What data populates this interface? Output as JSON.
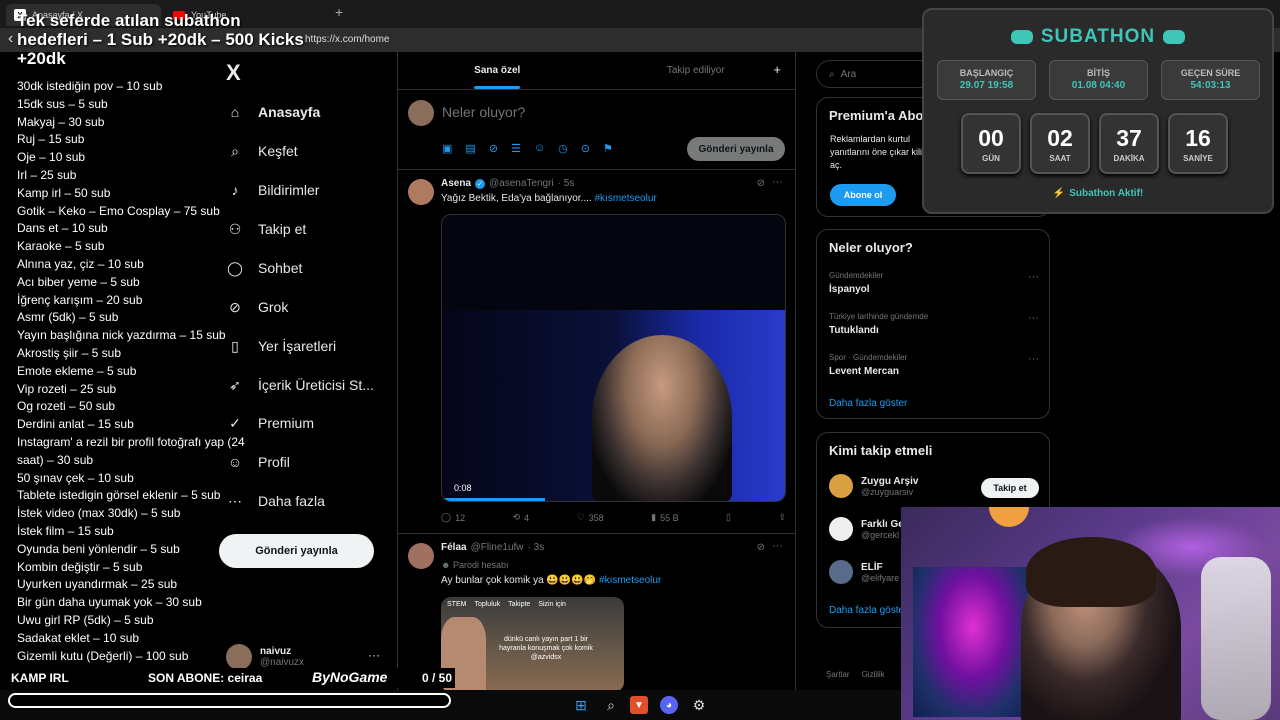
{
  "browser": {
    "tabs": [
      {
        "label": "Anasayfa / X"
      },
      {
        "label": "YouTube"
      }
    ],
    "new_tab": "+",
    "url": "https://x.com/home"
  },
  "left_nav": {
    "logo": "X",
    "items": [
      {
        "label": "Anasayfa",
        "icon": "home-icon",
        "active": true
      },
      {
        "label": "Keşfet",
        "icon": "search-icon"
      },
      {
        "label": "Bildirimler",
        "icon": "bell-icon"
      },
      {
        "label": "Takip et",
        "icon": "add-user-icon"
      },
      {
        "label": "Sohbet",
        "icon": "chat-icon"
      },
      {
        "label": "Grok",
        "icon": "grok-icon"
      },
      {
        "label": "Yer İşaretleri",
        "icon": "bookmark-icon"
      },
      {
        "label": "İçerik Üreticisi St...",
        "icon": "rocket-icon"
      },
      {
        "label": "Premium",
        "icon": "premium-icon"
      },
      {
        "label": "Profil",
        "icon": "person-icon"
      },
      {
        "label": "Daha fazla",
        "icon": "more-circle-icon"
      }
    ],
    "post_button": "Gönderi yayınla",
    "account": {
      "name": "naivuz",
      "handle": "@naivuzx",
      "more": "···"
    }
  },
  "timeline": {
    "tabs": [
      "Sana özel",
      "Takip ediliyor"
    ],
    "plus": "+",
    "compose_placeholder": "Neler oluyor?",
    "compose_button": "Gönderi yayınla",
    "tweets": [
      {
        "name": "Asena",
        "handle": "@asenaTengri",
        "time": "· 5s",
        "text": "Yağız Bektik, Eda'ya bağlanıyor....",
        "hashtag": "#kısmetseolur",
        "video_time": "0:08",
        "replies": "12",
        "retweets": "4",
        "likes": "358",
        "views": "55 B"
      },
      {
        "name": "Félaa",
        "handle": "@Fline1ufw",
        "time": "· 3s",
        "parody": "Parodi hesabı",
        "text": "Ay bunlar çok komik ya 😃😃😃🤭",
        "hashtag": "#kısmetseolur",
        "media_tabs": [
          "STEM",
          "Topluluk",
          "Takipte",
          "Sizin için"
        ],
        "media_caption": "dünkü canlı yayın part 1 bir hayranla konuşmak çok komik @azvidsx"
      }
    ]
  },
  "right_col": {
    "search_placeholder": "Ara",
    "premium": {
      "title": "Premium'a Abo",
      "text": "Reklamlardan kurtul yanıtlarını öne çıkar kilidini aç.",
      "button": "Abone ol"
    },
    "trends": {
      "title": "Neler oluyor?",
      "items": [
        {
          "context": "Gündemdekiler",
          "name": "İspanyol"
        },
        {
          "context": "Türkiye tarihinde gündemde",
          "name": "Tutuklandı"
        },
        {
          "context": "Spor · Gündemdekiler",
          "name": "Levent Mercan"
        }
      ],
      "show_more": "Daha fazla göster"
    },
    "who_to_follow": {
      "title": "Kimi takip etmeli",
      "items": [
        {
          "name": "Zuygu Arşiv",
          "handle": "@zuyguarsiv",
          "button": "Takip et"
        },
        {
          "name": "Farklı Ge",
          "handle": "@gercekl"
        },
        {
          "name": "ELİF",
          "handle": "@elifyare"
        }
      ],
      "show_more": "Daha fazla göste"
    },
    "footer": [
      "Şartlar",
      "Gizlilik"
    ]
  },
  "overlay": {
    "title": "Tek seferde atılan subathon hedefleri – 1 Sub +20dk – 500 Kicks +20dk",
    "list": [
      "30dk istediğin pov – 10 sub",
      "15dk sus – 5 sub",
      "Makyaj – 30 sub",
      "Ruj – 15 sub",
      "Oje – 10 sub",
      "Irl – 25 sub",
      "Kamp irl – 50 sub",
      "Gotik – Keko – Emo Cosplay – 75 sub",
      "Dans et – 10 sub",
      "Karaoke – 5 sub",
      "Alnına yaz, çiz – 10 sub",
      "Acı biber yeme – 5 sub",
      "İğrenç karışım – 20 sub",
      "Asmr (5dk) – 5 sub",
      "Yayın başlığına nick yazdırma – 15 sub",
      "Akrostiş şiir – 5 sub",
      "Emote ekleme – 5 sub",
      "Vip rozeti – 25 sub",
      "Og rozeti – 50 sub",
      "Derdini anlat – 15 sub",
      "Instagram' a rezil bir profil fotoğrafı yap (24 saat) – 30 sub",
      "50 şınav çek – 10 sub",
      "Tablete istedigin görsel eklenir – 5 sub",
      "İstek video (max 30dk) – 5 sub",
      "İstek film – 15 sub",
      "Oyunda beni yönlendir – 5 sub",
      "Kombin değiştir – 5 sub",
      "Uyurken uyandırmak – 25 sub",
      "Bir gün daha uyumak yok – 30 sub",
      "Uwu girl RP (5dk) – 5 sub",
      "Sadakat eklet – 10 sub",
      "Gizemli kutu (Değerli) – 100 sub"
    ],
    "bottom": {
      "kamp": "KAMP IRL",
      "son_abone": "SON ABONE: ceiraa",
      "logo": "ByNoGame",
      "progress_text": "0 / 50",
      "progress_fraction": 0
    }
  },
  "subathon": {
    "title": "SUBATHON",
    "start": {
      "label": "BAŞLANGIÇ",
      "value": "29.07 19:58"
    },
    "end": {
      "label": "BİTİŞ",
      "value": "01.08 04:40"
    },
    "elapsed": {
      "label": "GEÇEN SÜRE",
      "value": "54:03:13"
    },
    "countdown": [
      {
        "num": "00",
        "unit": "GÜN"
      },
      {
        "num": "02",
        "unit": "SAAT"
      },
      {
        "num": "37",
        "unit": "DAKİKA"
      },
      {
        "num": "16",
        "unit": "SANİYE"
      }
    ],
    "status": "Subathon Aktif!",
    "accent": "#3ec6b8"
  }
}
